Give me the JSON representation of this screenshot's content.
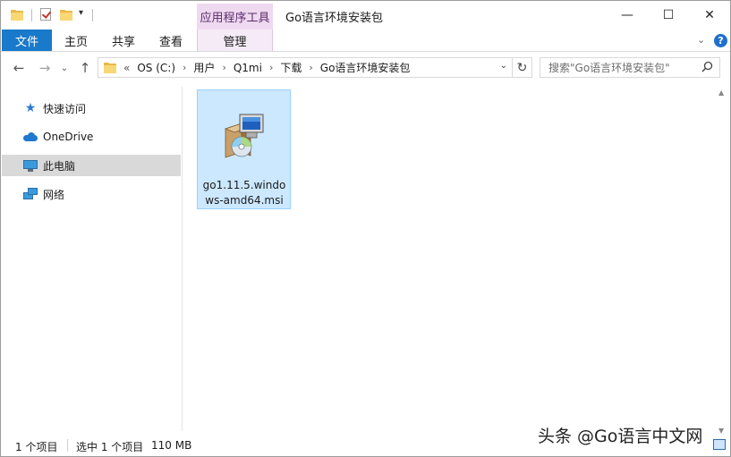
{
  "title_bar": {
    "contextual_tab": "应用程序工具",
    "window_title": "Go语言环境安装包",
    "qa_dropdown_icon": "dropdown-arrow",
    "buttons": {
      "minimize": "—",
      "maximize": "☐",
      "close": "✕"
    }
  },
  "ribbon": {
    "tabs": [
      {
        "label": "文件",
        "active": true
      },
      {
        "label": "主页"
      },
      {
        "label": "共享"
      },
      {
        "label": "查看"
      },
      {
        "label": "管理"
      }
    ],
    "collapse_icon": "⌄",
    "help_icon": "?"
  },
  "navigation": {
    "back": "←",
    "forward": "→",
    "recent": "⌄",
    "up": "↑"
  },
  "address_bar": {
    "overflow": "«",
    "breadcrumbs": [
      "OS (C:)",
      "用户",
      "Q1mi",
      "下载",
      "Go语言环境安装包"
    ],
    "separator": "›",
    "dropdown": "⌄",
    "refresh": "↻"
  },
  "search": {
    "placeholder": "搜索\"Go语言环境安装包\"",
    "icon": "⚲"
  },
  "nav_pane": {
    "items": [
      {
        "label": "快速访问",
        "icon": "star-icon"
      },
      {
        "label": "OneDrive",
        "icon": "cloud-icon"
      },
      {
        "label": "此电脑",
        "icon": "computer-icon",
        "selected": true
      },
      {
        "label": "网络",
        "icon": "network-icon"
      }
    ]
  },
  "files": [
    {
      "name": "go1.11.5.windows-amd64.msi",
      "icon": "msi-installer-icon",
      "selected": true
    }
  ],
  "status_bar": {
    "item_count": "1 个项目",
    "selection": "选中 1 个项目",
    "size": "110 MB"
  },
  "watermark": "头条 @Go语言中文网",
  "colors": {
    "file_tab": "#1979ca",
    "contextual_tab": "#efd9f0",
    "selection": "#cce8ff",
    "nav_selected": "#d9d9d9"
  }
}
